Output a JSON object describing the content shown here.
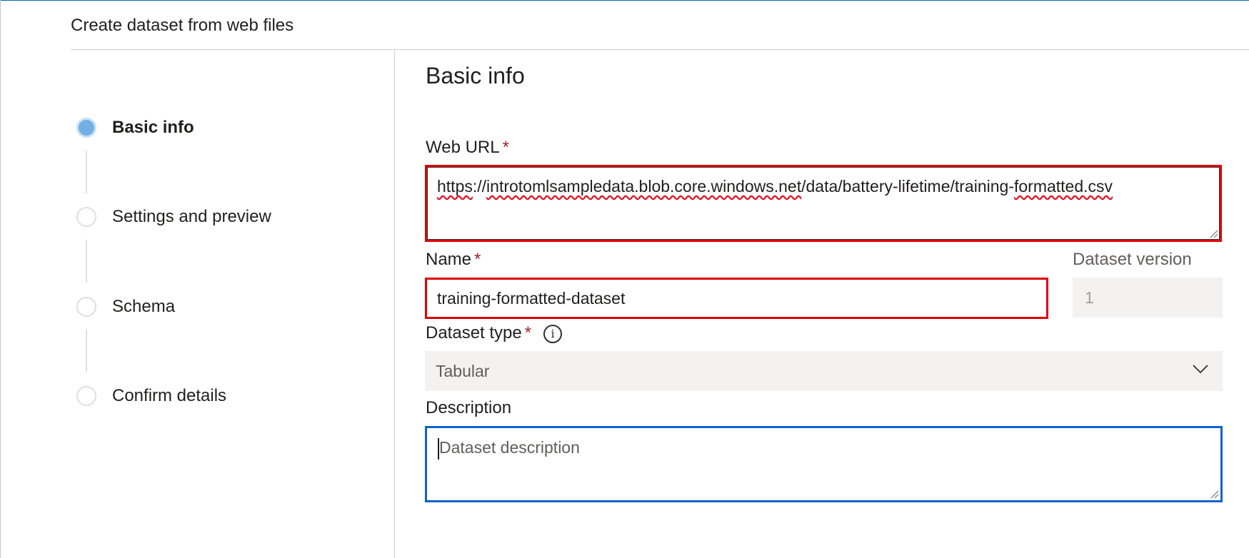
{
  "panel": {
    "title": "Create dataset from web files"
  },
  "steps": [
    {
      "label": "Basic info",
      "state": "active"
    },
    {
      "label": "Settings and preview",
      "state": "pending"
    },
    {
      "label": "Schema",
      "state": "pending"
    },
    {
      "label": "Confirm details",
      "state": "pending"
    }
  ],
  "form": {
    "section_title": "Basic info",
    "required_marker": "*",
    "web_url": {
      "label": "Web URL",
      "value_parts": [
        "https",
        "://",
        "introtomlsampledata.blob.core.windows.net",
        "/data/battery-lifetime/training-",
        "formatted.csv"
      ]
    },
    "name": {
      "label": "Name",
      "value": "training-formatted-dataset"
    },
    "dataset_version": {
      "label": "Dataset version",
      "value": "1"
    },
    "dataset_type": {
      "label": "Dataset type",
      "value": "Tabular",
      "info_icon": "info-icon",
      "dropdown_icon": "chevron-down-icon"
    },
    "description": {
      "label": "Description",
      "placeholder": "Dataset description",
      "value": ""
    }
  },
  "colors": {
    "highlight_border": "#e00000",
    "focus_border": "#0f62d0",
    "active_step": "#71afe5",
    "required": "#a4262c",
    "top_accent": "#0a6fb5"
  }
}
